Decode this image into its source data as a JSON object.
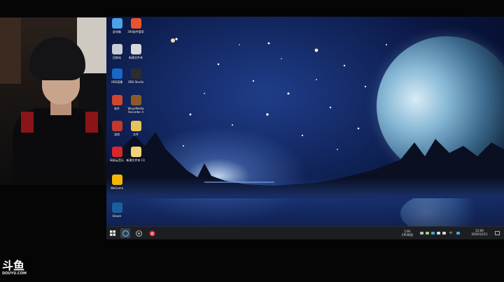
{
  "desktop_icons": [
    {
      "label": "此电脑",
      "icon": "computer-icon",
      "color": "#4aa3e6"
    },
    {
      "label": "360软件管家",
      "icon": "360-app-icon",
      "color": "#e9542f"
    },
    {
      "label": "回收站",
      "icon": "recycle-bin-icon",
      "color": "#c7cdd4"
    },
    {
      "label": "新建文件夹",
      "icon": "folder-camera-icon",
      "color": "#d8d8d8"
    },
    {
      "label": "OBS直播",
      "icon": "obs-icon",
      "color": "#1b67c8"
    },
    {
      "label": "OBS Studio",
      "icon": "obs-studio-icon",
      "color": "#2d2d2d"
    },
    {
      "label": "软件",
      "icon": "colorful-app-icon",
      "color": "#d1452f"
    },
    {
      "label": "WeyeMedia Recorder 4",
      "icon": "recorder-icon",
      "color": "#8b5a2b"
    },
    {
      "label": "游戏",
      "icon": "game-folder-icon",
      "color": "#c0392b"
    },
    {
      "label": "文件",
      "icon": "folder-icon",
      "color": "#e8c25c"
    },
    {
      "label": "网易云音乐",
      "icon": "netease-music-icon",
      "color": "#d8262e"
    },
    {
      "label": "新建文件夹 (1)",
      "icon": "new-folder-icon",
      "color": "#f0d27a"
    },
    {
      "label": "WeGame",
      "icon": "wegame-icon",
      "color": "#f2b705"
    },
    {
      "label": "Steam",
      "icon": "steam-icon",
      "color": "#1b5f9e"
    }
  ],
  "taskbar": {
    "apps": [
      {
        "name": "start-button",
        "icon": "windows-icon"
      },
      {
        "name": "taskbar-app-browser",
        "icon": "browser-icon"
      },
      {
        "name": "taskbar-app-obs",
        "icon": "obs-icon"
      },
      {
        "name": "taskbar-app-netease",
        "icon": "netease-music-icon"
      }
    ],
    "cpu_percent": "13%",
    "cpu_label": "CPU利用",
    "ime": "中",
    "time": "21:09",
    "date": "2020/12/11"
  },
  "logo": {
    "mark": "斗鱼",
    "sub": "DOUYU.COM"
  },
  "colors": {
    "taskbar_bg": "#1d1e22",
    "accent": "#4aa3e6"
  }
}
